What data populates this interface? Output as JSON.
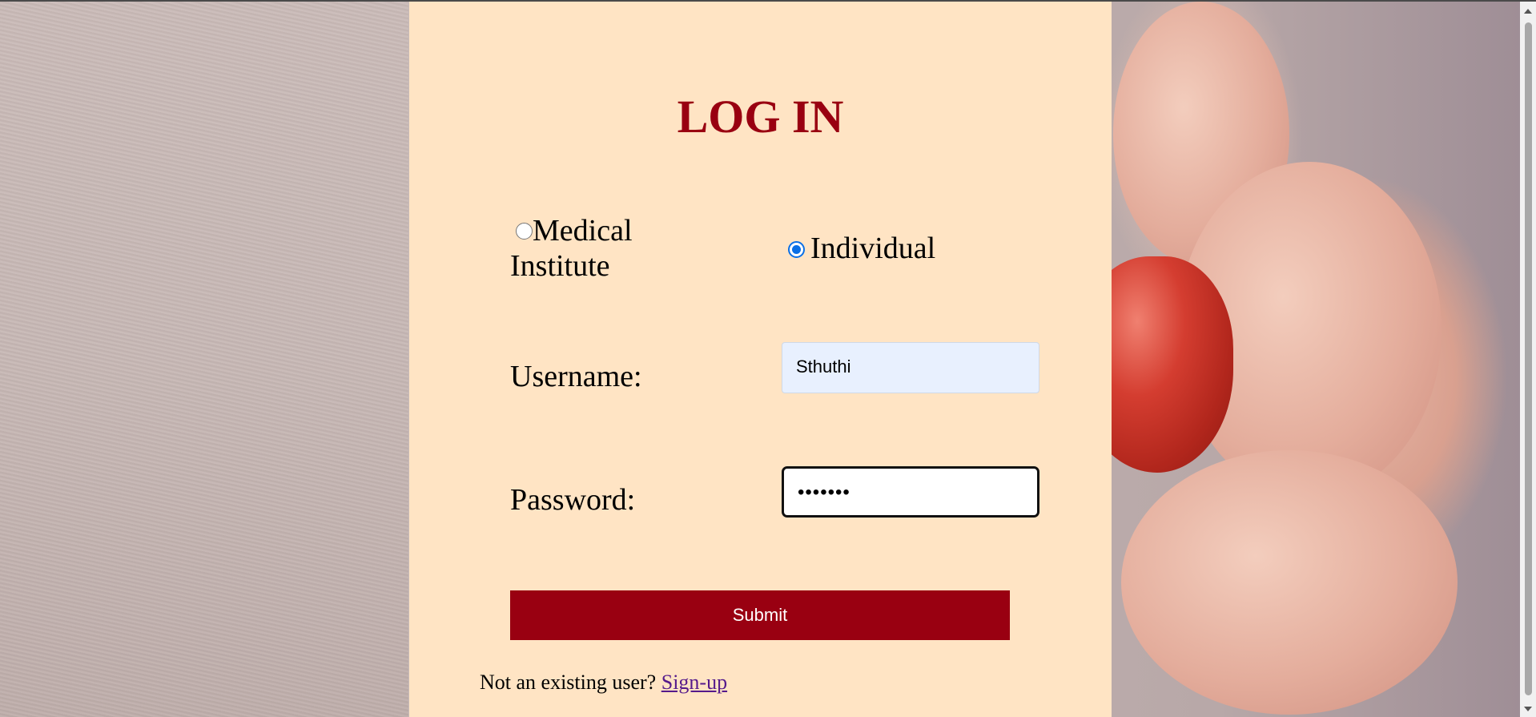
{
  "login": {
    "title": "LOG IN",
    "account_types": [
      {
        "label": "Medical Institute",
        "selected": false
      },
      {
        "label": "Individual",
        "selected": true
      }
    ],
    "username_label": "Username:",
    "username_value": "Sthuthi",
    "password_label": "Password:",
    "password_value": "•••••••",
    "submit_label": "Submit",
    "signup_prompt": "Not an existing user?",
    "signup_link": "Sign-up"
  },
  "colors": {
    "accent": "#990011",
    "card_background": "#ffe4c4",
    "link": "#551a8b",
    "radio_checked": "#0a6fe6"
  }
}
